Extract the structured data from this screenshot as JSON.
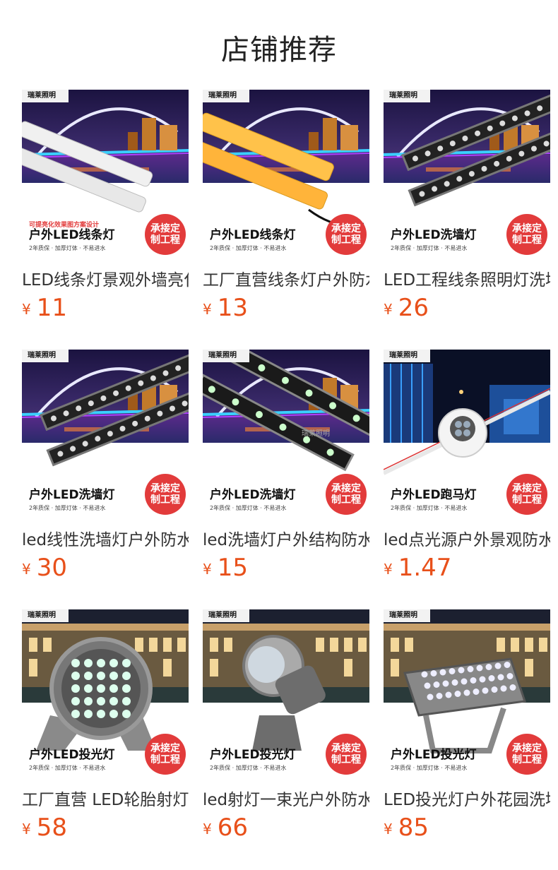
{
  "page_title": "店铺推荐",
  "shared": {
    "brand": "瑞莱照明",
    "badge": "承接定\n制工程",
    "promo_sub": "2年质保 · 加厚灯体 · 不易进水",
    "currency": "¥"
  },
  "products": [
    {
      "type": "linear",
      "promo": "户外LED线条灯",
      "note": "可提亮化效果图方案设计",
      "name": "LED线条灯景观外墙亮化",
      "price": "11"
    },
    {
      "type": "linear-yellow",
      "promo": "户外LED线条灯",
      "name": "工厂直营线条灯户外防水",
      "price": "13"
    },
    {
      "type": "washer",
      "promo": "户外LED洗墙灯",
      "name": "LED工程线条照明灯洗墙",
      "price": "26"
    },
    {
      "type": "washer",
      "promo": "户外LED洗墙灯",
      "name": "led线性洗墙灯户外防水",
      "price": "30"
    },
    {
      "type": "washer2",
      "promo": "户外LED洗墙灯",
      "watermark": "瑞莱照明",
      "name": "led洗墙灯户外结构防水",
      "price": "15"
    },
    {
      "type": "point",
      "promo": "户外LED跑马灯",
      "name": "led点光源户外景观防水",
      "price": "1.47"
    },
    {
      "type": "flood-round",
      "promo": "户外LED投光灯",
      "name": "工厂直营 LED轮胎射灯",
      "price": "58"
    },
    {
      "type": "spot",
      "promo": "户外LED投光灯",
      "name": "led射灯一束光户外防水",
      "price": "66"
    },
    {
      "type": "flood-rect",
      "promo": "户外LED投光灯",
      "name": "LED投光灯户外花园洗墙",
      "price": "85"
    }
  ],
  "colors": {
    "price": "#e8501a",
    "badge": "#e23b3b"
  }
}
